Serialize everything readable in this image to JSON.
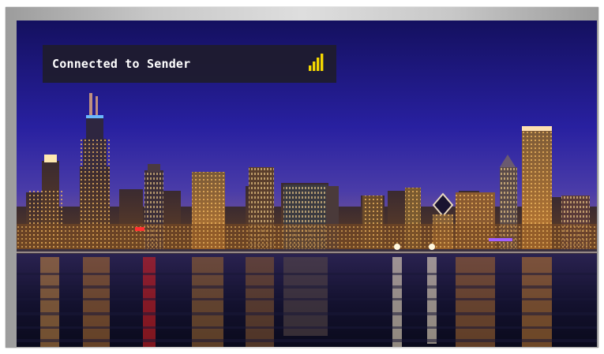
{
  "status": {
    "text": "Connected to Sender",
    "signal_icon": "signal-strength-icon",
    "signal_bars": 4,
    "signal_color": "#f5d800"
  },
  "background": {
    "scene": "city-skyline-night-icon",
    "colors": {
      "sky_top": "#141063",
      "sky_mid": "#2a20a0",
      "horizon": "#4a3aa6",
      "water": "#0e0d2a"
    }
  }
}
